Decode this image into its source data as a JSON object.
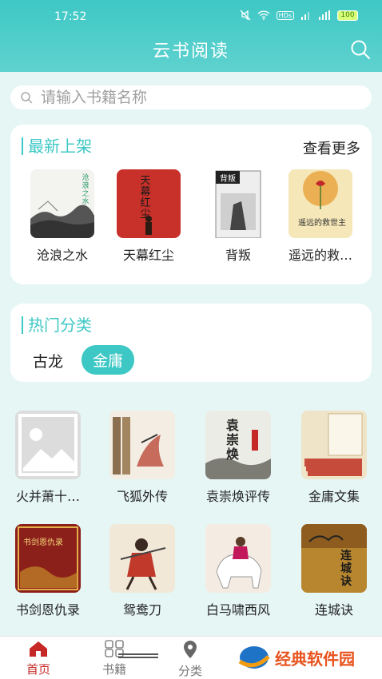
{
  "status": {
    "time": "17:52",
    "network": "HDs",
    "battery": "100"
  },
  "header": {
    "title": "云书阅读"
  },
  "search": {
    "placeholder": "请输入书籍名称"
  },
  "new_section": {
    "title": "最新上架",
    "more": "查看更多",
    "books": [
      {
        "title": "沧浪之水",
        "cover_text": "沧浪之水"
      },
      {
        "title": "天幕红尘",
        "cover_text": "天幕红尘"
      },
      {
        "title": "背叛",
        "cover_text": "背叛"
      },
      {
        "title": "遥远的救…",
        "cover_text": "遥远的救世主"
      }
    ]
  },
  "hot_section": {
    "title": "热门分类",
    "tags": [
      {
        "label": "古龙",
        "active": false
      },
      {
        "label": "金庸",
        "active": true
      }
    ]
  },
  "grid_books": [
    {
      "title": "火并萧十…"
    },
    {
      "title": "飞狐外传"
    },
    {
      "title": "袁崇焕评传",
      "cover_text": "袁崇焕"
    },
    {
      "title": "金庸文集"
    },
    {
      "title": "书剑恩仇录",
      "cover_text": "书剑恩仇录"
    },
    {
      "title": "鸳鸯刀"
    },
    {
      "title": "白马啸西风"
    },
    {
      "title": "连城诀",
      "cover_text": "连城诀"
    }
  ],
  "bottom_nav": [
    {
      "label": "首页",
      "active": true,
      "icon": "home-icon"
    },
    {
      "label": "书籍",
      "active": false,
      "icon": "grid-icon"
    },
    {
      "label": "分类",
      "active": false,
      "icon": "location-pin-icon"
    }
  ],
  "watermark": {
    "text": "经典软件园"
  },
  "colors": {
    "accent": "#3ec8c5",
    "active_nav": "#c62828",
    "background": "#e6f6f5"
  }
}
